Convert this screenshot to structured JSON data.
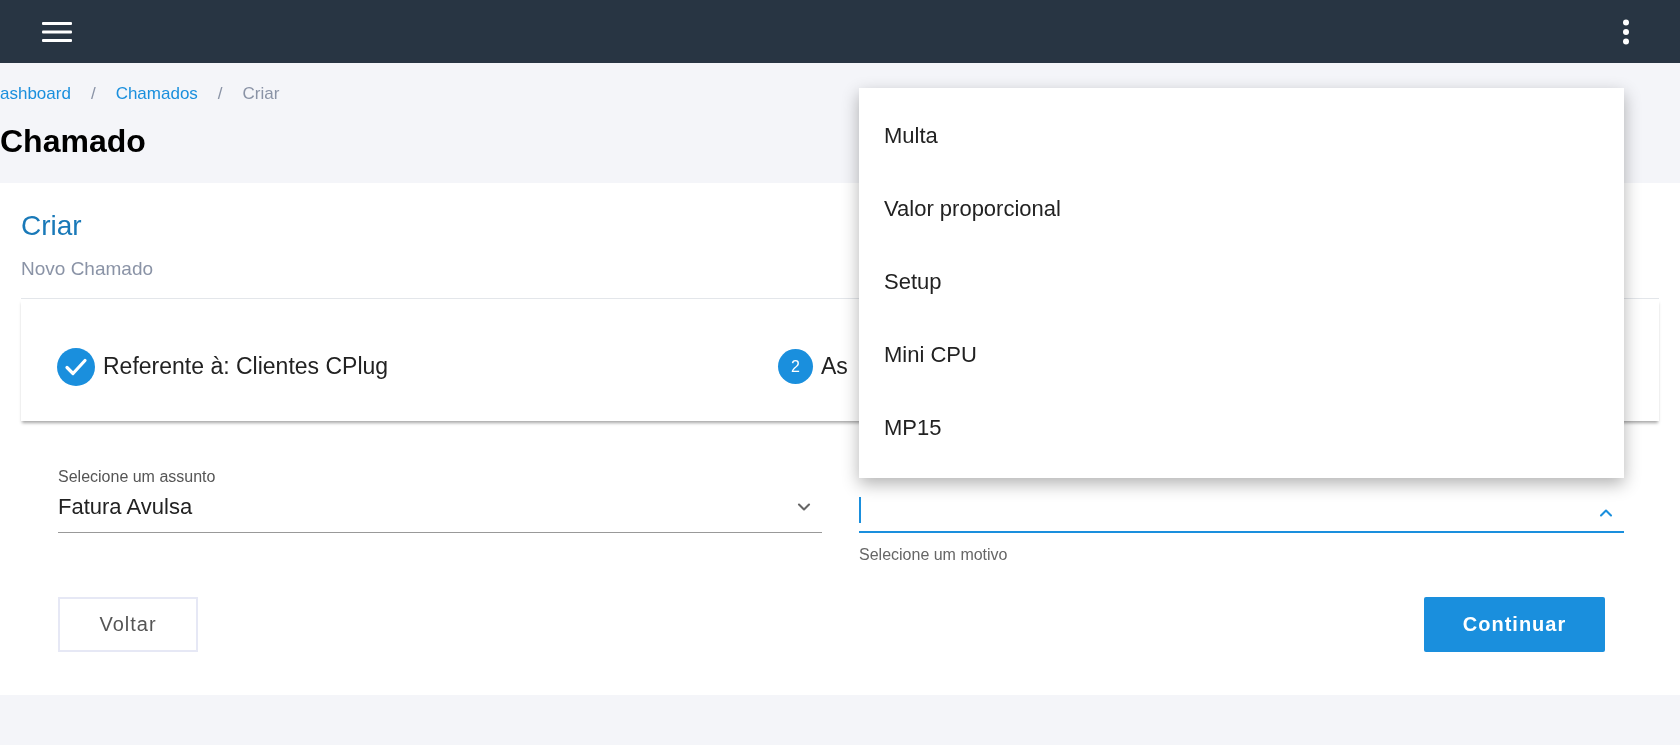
{
  "breadcrumb": {
    "separator": "/",
    "items": [
      {
        "label": "ashboard",
        "kind": "link"
      },
      {
        "label": "Chamados",
        "kind": "link"
      },
      {
        "label": "Criar",
        "kind": "current"
      }
    ]
  },
  "page_title": "Chamado",
  "card": {
    "title": "Criar",
    "subtitle": "Novo Chamado",
    "steps": [
      {
        "label": "Referente à: Clientes CPlug",
        "completed": true
      },
      {
        "number": "2",
        "label": "As",
        "completed": false
      }
    ],
    "subject_field": {
      "label": "Selecione um assunto",
      "value": "Fatura Avulsa"
    },
    "reason_field": {
      "helper": "Selecione um motivo",
      "focused": true,
      "expanded": true
    },
    "buttons": {
      "back": "Voltar",
      "continue": "Continuar"
    }
  },
  "dropdown_options": [
    {
      "label": "Multa",
      "selected": false
    },
    {
      "label": "Valor proporcional",
      "selected": false
    },
    {
      "label": "Setup",
      "selected": false
    },
    {
      "label": "Mini CPU",
      "selected": false
    },
    {
      "label": "MP15",
      "selected": false
    }
  ]
}
